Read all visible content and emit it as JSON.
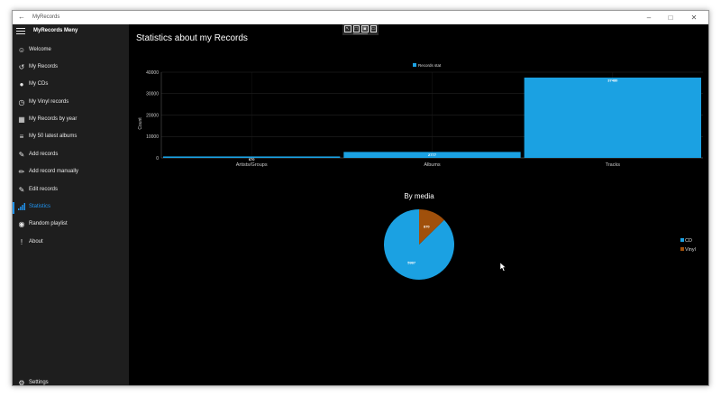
{
  "window": {
    "app_title": "MyRecords",
    "back_icon": "back-arrow-icon",
    "controls": [
      "minimize",
      "maximize",
      "close"
    ]
  },
  "toolbar": {
    "buttons": [
      "select-element-icon",
      "display-layout-icon",
      "track-focus-icon",
      "xaml-binding-icon"
    ]
  },
  "sidebar": {
    "title": "MyRecords Meny",
    "items": [
      {
        "label": "Welcome",
        "icon": "smiley-icon"
      },
      {
        "label": "My Records",
        "icon": "history-icon"
      },
      {
        "label": "My CDs",
        "icon": "disc-icon"
      },
      {
        "label": "My Vinyl records",
        "icon": "clock-icon"
      },
      {
        "label": "My Records by year",
        "icon": "calendar-icon"
      },
      {
        "label": "My 50 latest albums",
        "icon": "list-icon"
      },
      {
        "label": "Add records",
        "icon": "edit-icon"
      },
      {
        "label": "Add record manually",
        "icon": "pencil-icon"
      },
      {
        "label": "Edit records",
        "icon": "edit-pencil-icon"
      },
      {
        "label": "Statistics",
        "icon": "bar-chart-icon"
      },
      {
        "label": "Random playlist",
        "icon": "globe-icon"
      },
      {
        "label": "About",
        "icon": "exclamation-icon"
      }
    ],
    "settings_label": "Settings",
    "active_label": "Statistics",
    "accent_color": "#2196f3"
  },
  "main": {
    "page_title": "Statistics about my Records"
  },
  "chart_data": [
    {
      "type": "bar",
      "title": "",
      "legend": [
        "Records stat"
      ],
      "legend_position": "top",
      "categories": [
        "Artists/Groups",
        "Albums",
        "Tracks"
      ],
      "values": [
        670,
        2777,
        37480
      ],
      "value_labels": [
        "670",
        "2777",
        "37480"
      ],
      "ylabel": "Count",
      "xlabel": "",
      "ylim": [
        0,
        40000
      ],
      "yticks": [
        "0",
        "10000",
        "20000",
        "30000",
        "40000"
      ],
      "grid": true,
      "color": "#1ba1e2"
    },
    {
      "type": "pie",
      "title": "By media",
      "categories": [
        "CD",
        "Vinyl"
      ],
      "values": [
        5987,
        870
      ],
      "value_labels": [
        "5987",
        "870"
      ],
      "colors": [
        "#1ba1e2",
        "#a0500b"
      ],
      "legend_position": "right"
    }
  ]
}
